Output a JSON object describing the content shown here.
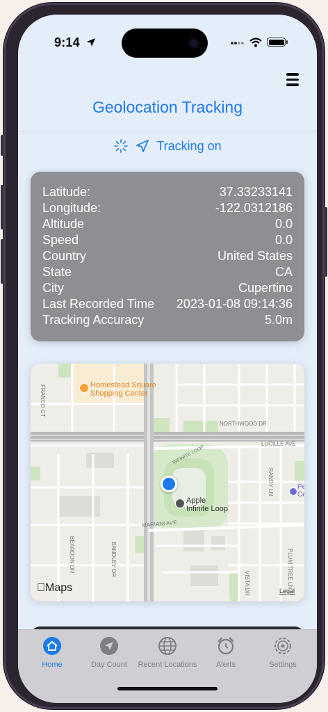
{
  "status": {
    "time": "9:14"
  },
  "header": {
    "title": "Geolocation Tracking",
    "tracking_label": "Tracking on"
  },
  "location": {
    "rows": [
      {
        "label": "Latitude:",
        "value": "37.33233141"
      },
      {
        "label": "Longitude:",
        "value": "-122.0312186"
      },
      {
        "label": "Altitude",
        "value": "0.0"
      },
      {
        "label": "Speed",
        "value": "0.0"
      },
      {
        "label": "Country",
        "value": "United States"
      },
      {
        "label": "State",
        "value": "CA"
      },
      {
        "label": "City",
        "value": "Cupertino"
      },
      {
        "label": "Last Recorded Time",
        "value": "2023-01-08 09:14:36"
      },
      {
        "label": "Tracking Accuracy",
        "value": "5.0m"
      }
    ]
  },
  "map": {
    "brand": "Maps",
    "legal": "Legal",
    "poi_homestead": [
      "Homestead Square",
      "Shopping Center"
    ],
    "poi_apple": [
      "Apple",
      "Infinite Loop"
    ],
    "poi_right": [
      "Pe",
      "Ce"
    ],
    "streets": {
      "northwood": "NORTHWOOD DR",
      "lucille": "LUCILLE AVE",
      "infinite": "INFINITE LOOP",
      "mariani": "MARIANI AVE",
      "franco": "FRANCO CT",
      "beardon": "BEARDON DR",
      "bandley": "BANDLEY DR",
      "randy": "RANDY LN",
      "vista": "VISTA DR",
      "plum": "PLUM TREE LN"
    }
  },
  "tabs": [
    {
      "label": "Home",
      "icon": "home-icon"
    },
    {
      "label": "Day Count",
      "icon": "navigation-icon"
    },
    {
      "label": "Recent Locations",
      "icon": "globe-icon"
    },
    {
      "label": "Alerts",
      "icon": "alarm-icon"
    },
    {
      "label": "Settings",
      "icon": "gear-icon"
    }
  ],
  "colors": {
    "accent": "#1f7ae9",
    "card": "#8e8e93",
    "tab_inactive": "#7f7f83"
  }
}
